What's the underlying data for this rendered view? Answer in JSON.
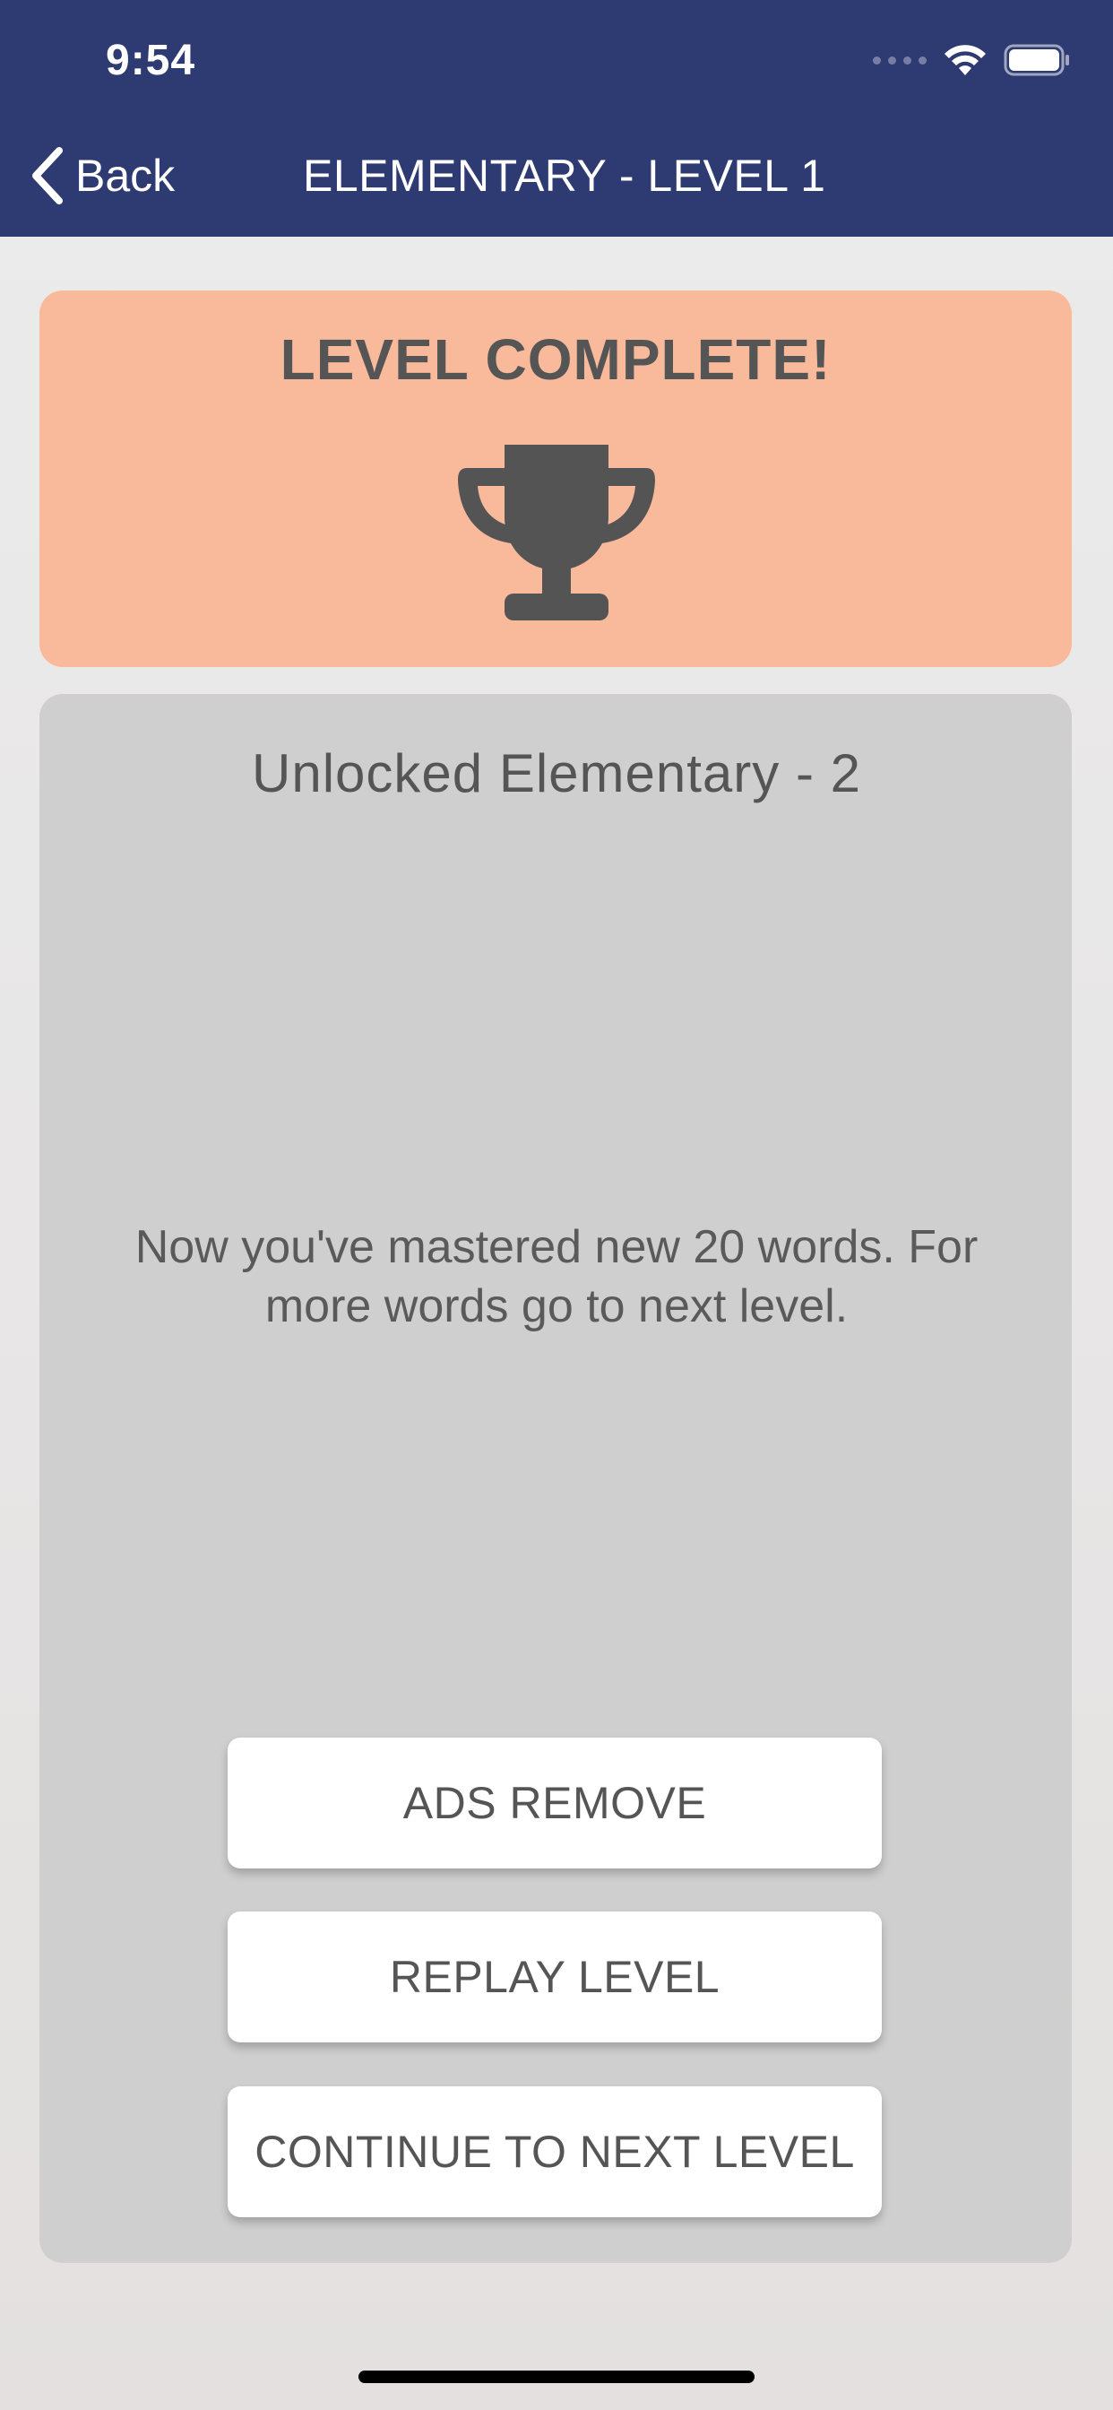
{
  "status_bar": {
    "time": "9:54"
  },
  "nav": {
    "back_label": "Back",
    "title": "ELEMENTARY - LEVEL 1"
  },
  "result": {
    "title": "LEVEL COMPLETE!",
    "icon": "trophy-icon"
  },
  "info": {
    "unlocked": "Unlocked Elementary - 2",
    "message": "Now you've mastered new 20 words. For more words go to next level."
  },
  "buttons": {
    "ads_remove": "ADS REMOVE",
    "replay": "REPLAY LEVEL",
    "continue": "CONTINUE TO NEXT LEVEL"
  },
  "colors": {
    "nav_bar": "#2e3a72",
    "complete_card": "#f9b99b",
    "panel": "#cfcfcf",
    "text": "#555555"
  }
}
